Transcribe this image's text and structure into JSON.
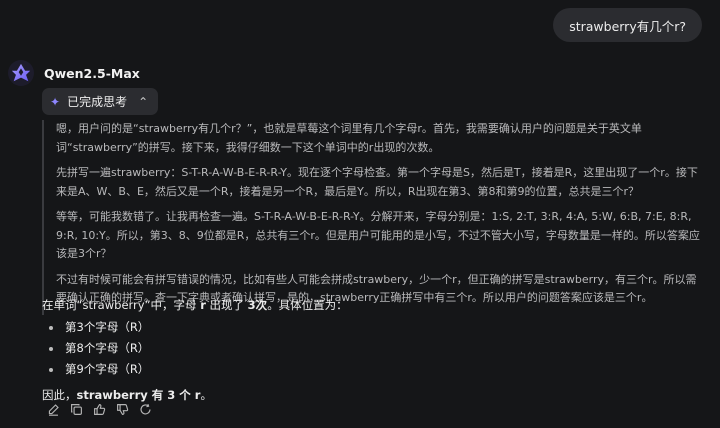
{
  "user_message": "strawberry有几个r?",
  "assistant": {
    "name": "Qwen2.5-Max",
    "thinking_toggle_label": "已完成思考",
    "thinking_paragraphs": [
      "嗯，用户问的是“strawberry有几个r？”，也就是草莓这个词里有几个字母r。首先，我需要确认用户的问题是关于英文单词“strawberry”的拼写。接下来，我得仔细数一下这个单词中的r出现的次数。",
      "先拼写一遍strawberry：S-T-R-A-W-B-E-R-R-Y。现在逐个字母检查。第一个字母是S，然后是T，接着是R，这里出现了一个r。接下来是A、W、B、E，然后又是一个R，接着是另一个R，最后是Y。所以，R出现在第3、第8和第9的位置，总共是三个r？",
      "等等，可能我数错了。让我再检查一遍。S-T-R-A-W-B-E-R-R-Y。分解开来，字母分别是：1:S, 2:T, 3:R, 4:A, 5:W, 6:B, 7:E, 8:R, 9:R, 10:Y。所以，第3、8、9位都是R，总共有三个r。但是用户可能用的是小写，不过不管大小写，字母数量是一样的。所以答案应该是3个r？",
      "不过有时候可能会有拼写错误的情况，比如有些人可能会拼成strawbery，少一个r，但正确的拼写是strawberry，有三个r。所以需要确认正确的拼写。查一下字典或者确认拼写，是的，strawberry正确拼写中有三个r。所以用户的问题答案应该是三个r。"
    ],
    "answer": {
      "intro_1": "在单词“strawberry”中，字母 ",
      "intro_letter": "r",
      "intro_2": " 出现了 ",
      "intro_count": "3次",
      "intro_3": "。具体位置为：",
      "positions": [
        "第3个字母（R）",
        "第8个字母（R）",
        "第9个字母（R）"
      ],
      "conclusion_1": "因此，",
      "conclusion_bold": "strawberry 有 3 个 r",
      "conclusion_2": "。"
    },
    "actions": [
      "edit-icon",
      "copy-icon",
      "thumbs-up-icon",
      "thumbs-down-icon",
      "regenerate-icon"
    ]
  },
  "colors": {
    "background": "#151618",
    "bubble": "#2b2c30",
    "accent": "#8e86ff"
  }
}
